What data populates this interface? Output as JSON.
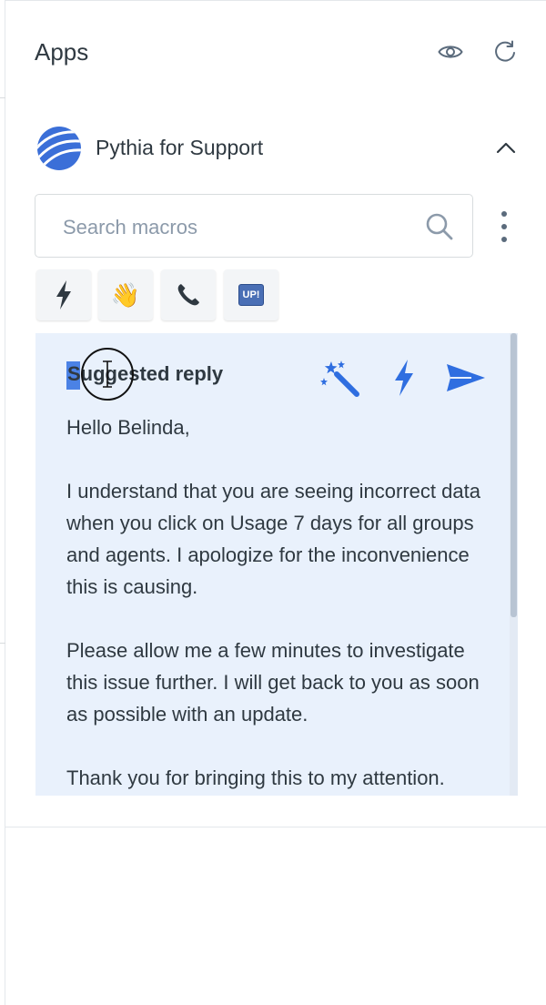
{
  "panel": {
    "title": "Apps",
    "icons": {
      "visibility": "eye-icon",
      "refresh": "refresh-icon"
    }
  },
  "app": {
    "name": "Pythia for Support",
    "logo_color": "#3b6fd8",
    "collapse_icon": "chevron-up-icon"
  },
  "search": {
    "placeholder": "Search macros",
    "value": "",
    "icon": "search-icon",
    "menu_icon": "kebab-menu-icon"
  },
  "quick_actions": [
    {
      "icon": "lightning-bolt-icon",
      "glyph": "⚡"
    },
    {
      "icon": "waving-hand-icon",
      "glyph": "👋"
    },
    {
      "icon": "telephone-icon",
      "glyph": "📞"
    },
    {
      "icon": "up-button-icon",
      "glyph": "UP!"
    }
  ],
  "reply": {
    "title": "Suggested reply",
    "actions": [
      "magic-wand-icon",
      "lightning-bolt-icon",
      "send-icon"
    ],
    "greeting": "Hello Belinda,",
    "paragraph1": "I understand that you are seeing incorrect data when you click on Usage 7 days for all groups and agents. I apologize for the inconvenience this is causing.",
    "paragraph2": "Please allow me a few minutes to investigate this issue further. I will get back to you as soon as possible with an update.",
    "paragraph3": "Thank you for bringing this to my attention."
  },
  "colors": {
    "accent": "#2f6ee0",
    "card_bg": "#e9f1fc",
    "text": "#2f3941",
    "muted": "#8c9aaa"
  }
}
